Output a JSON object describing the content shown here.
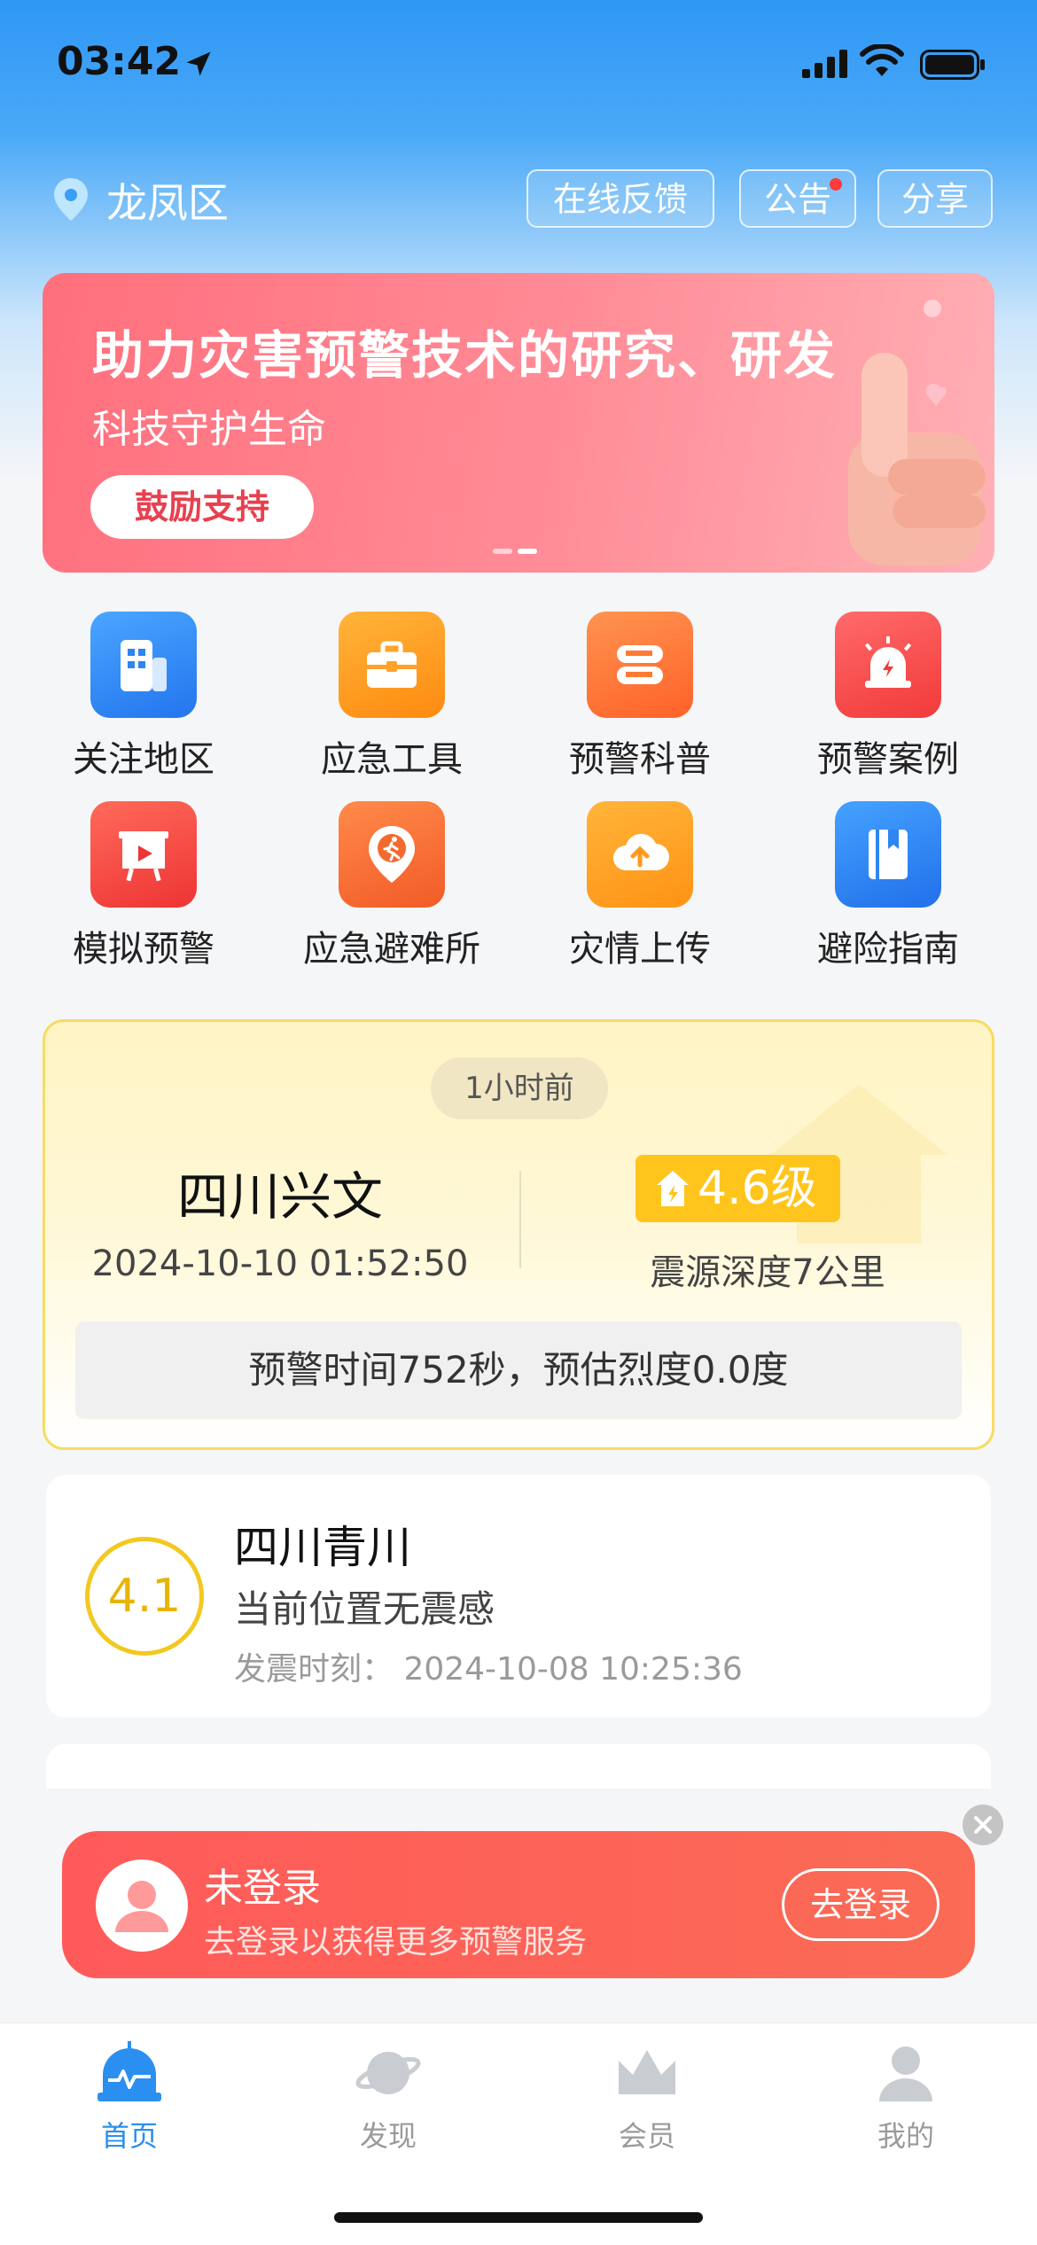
{
  "status_bar": {
    "time": "03:42"
  },
  "header": {
    "location": "龙凤区",
    "feedback_label": "在线反馈",
    "notice_label": "公告",
    "share_label": "分享"
  },
  "banner": {
    "title": "助力灾害预警技术的研究、研发",
    "subtitle": "科技守护生命",
    "button_label": "鼓励支持"
  },
  "grid": {
    "items": [
      {
        "label": "关注地区",
        "icon": "building-icon",
        "color": "#2f86f6"
      },
      {
        "label": "应急工具",
        "icon": "toolbox-icon",
        "color": "#ff9a1f"
      },
      {
        "label": "预警科普",
        "icon": "book-stack-icon",
        "color": "#ff7a35"
      },
      {
        "label": "预警案例",
        "icon": "alarm-light-icon",
        "color": "#ff4a4a"
      },
      {
        "label": "模拟预警",
        "icon": "presentation-icon",
        "color": "#ff4d4d"
      },
      {
        "label": "应急避难所",
        "icon": "shelter-pin-icon",
        "color": "#ff7036"
      },
      {
        "label": "灾情上传",
        "icon": "cloud-upload-icon",
        "color": "#ffa21f"
      },
      {
        "label": "避险指南",
        "icon": "guide-book-icon",
        "color": "#2d86f2"
      }
    ]
  },
  "main_quake": {
    "ago": "1小时前",
    "place": "四川兴文",
    "datetime": "2024-10-10 01:52:50",
    "magnitude": "4.6级",
    "depth": "震源深度7公里",
    "warning": "预警时间752秒，预估烈度0.0度"
  },
  "quake2": {
    "magnitude": "4.1",
    "place": "四川青川",
    "feel": "当前位置无震感",
    "time": "发震时刻：  2024-10-08 10:25:36"
  },
  "login": {
    "title": "未登录",
    "subtitle": "去登录以获得更多预警服务",
    "button_label": "去登录"
  },
  "tabs": [
    {
      "label": "首页",
      "icon": "alarm-home-icon"
    },
    {
      "label": "发现",
      "icon": "planet-icon"
    },
    {
      "label": "会员",
      "icon": "crown-icon"
    },
    {
      "label": "我的",
      "icon": "person-icon"
    }
  ],
  "colors": {
    "accent": "#2a8ff0",
    "warning_yellow": "#ffc51d",
    "login_red": "#ff5a5a"
  }
}
